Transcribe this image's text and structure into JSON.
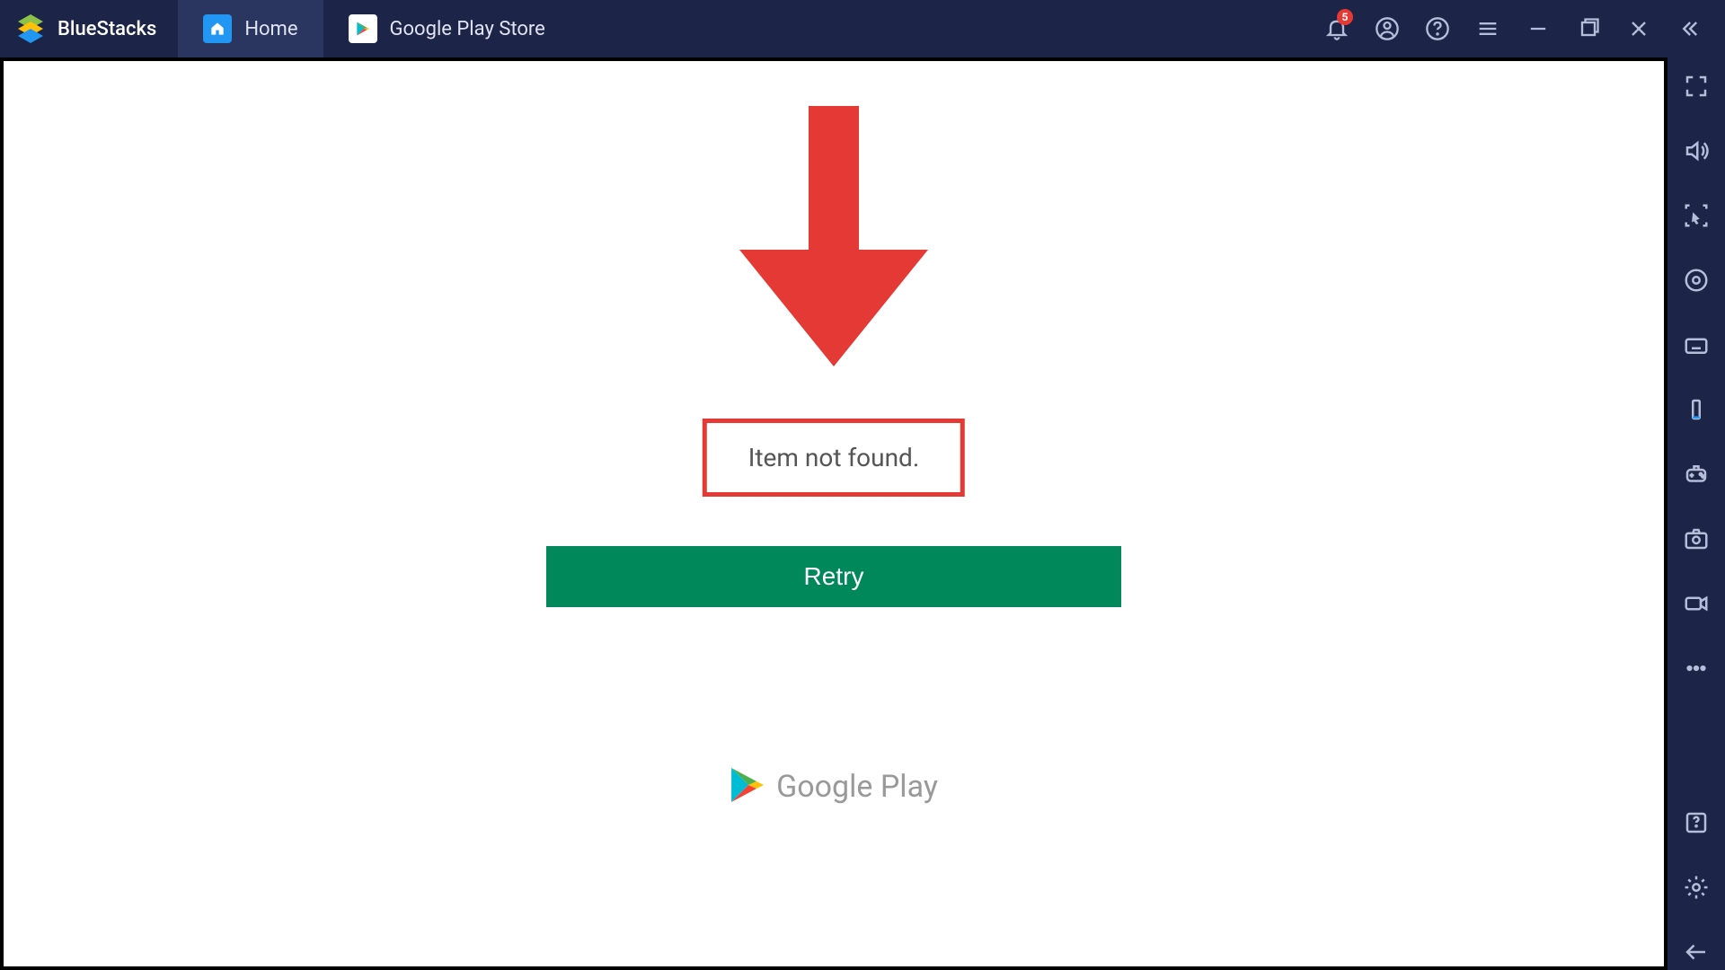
{
  "app": {
    "name": "BlueStacks"
  },
  "tabs": [
    {
      "label": "Home",
      "icon": "home-icon",
      "active": false
    },
    {
      "label": "Google Play Store",
      "icon": "play-store-icon",
      "active": true
    }
  ],
  "titlebar": {
    "notification_badge": "5"
  },
  "content": {
    "error_message": "Item not found.",
    "retry_label": "Retry",
    "footer_brand": "Google Play"
  },
  "colors": {
    "titlebar_bg": "#1c2448",
    "tab_active_bg": "#2a3560",
    "retry_green": "#00875a",
    "annotation_red": "#e53935",
    "play_blue": "#2196f3"
  }
}
